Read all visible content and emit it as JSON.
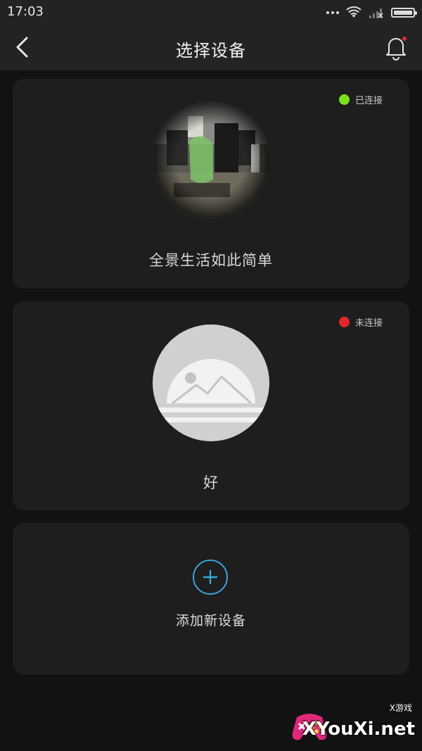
{
  "status_bar": {
    "time": "17:03"
  },
  "header": {
    "title": "选择设备"
  },
  "devices": [
    {
      "name": "全景生活如此简单",
      "status": "已连接",
      "status_color": "#7ee21b"
    },
    {
      "name": "好",
      "status": "未连接",
      "status_color": "#e02a2a"
    }
  ],
  "add_device": {
    "label": "添加新设备"
  },
  "watermark": {
    "brand": "XYouXi.net",
    "tag": "X游戏"
  },
  "colors": {
    "accent": "#3aa6d6",
    "background": "#121212",
    "card": "#1e1e1e"
  }
}
